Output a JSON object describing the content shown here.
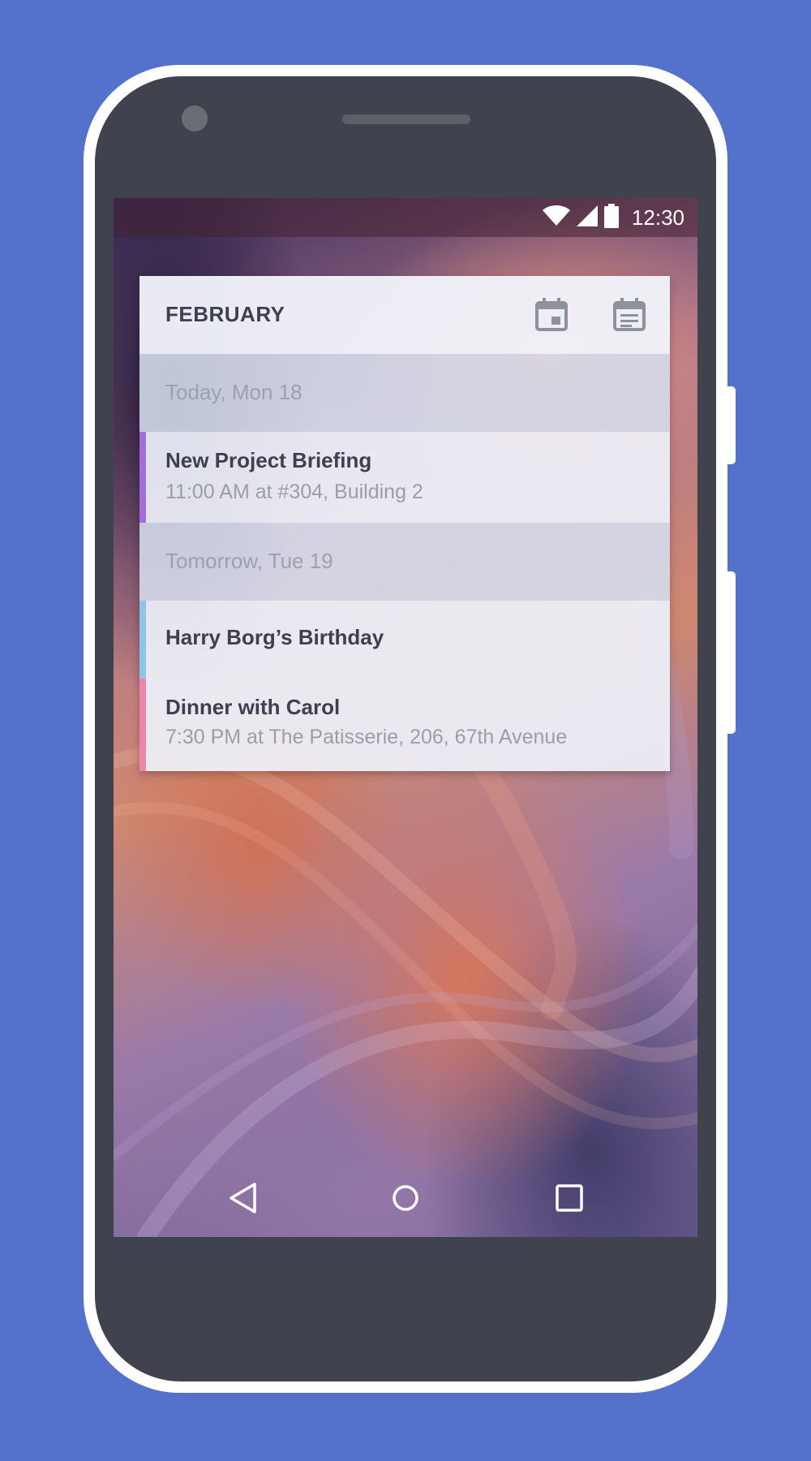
{
  "status_bar": {
    "time": "12:30",
    "icons": [
      "wifi-icon",
      "signal-icon",
      "battery-icon"
    ]
  },
  "widget": {
    "title": "FEBRUARY",
    "header_icons": [
      "calendar-day-icon",
      "agenda-icon"
    ],
    "days": [
      {
        "label": "Today, Mon 18",
        "events": [
          {
            "title": "New Project Briefing",
            "detail": "11:00 AM at #304, Building 2",
            "color": "#a46ed8"
          }
        ]
      },
      {
        "label": "Tomorrow, Tue 19",
        "events": [
          {
            "title": "Harry Borg’s Birthday",
            "detail": "",
            "color": "#8ec5e6"
          },
          {
            "title": "Dinner with Carol",
            "detail": "7:30 PM at The Patisserie, 206, 67th Avenue",
            "color": "#ee84aa"
          }
        ]
      }
    ]
  },
  "nav_bar": {
    "icons": [
      "back-icon",
      "home-icon",
      "recents-icon"
    ]
  },
  "colors": {
    "background": "#5472cc",
    "phone_frame": "#ffffff",
    "phone_body": "#40434e"
  }
}
